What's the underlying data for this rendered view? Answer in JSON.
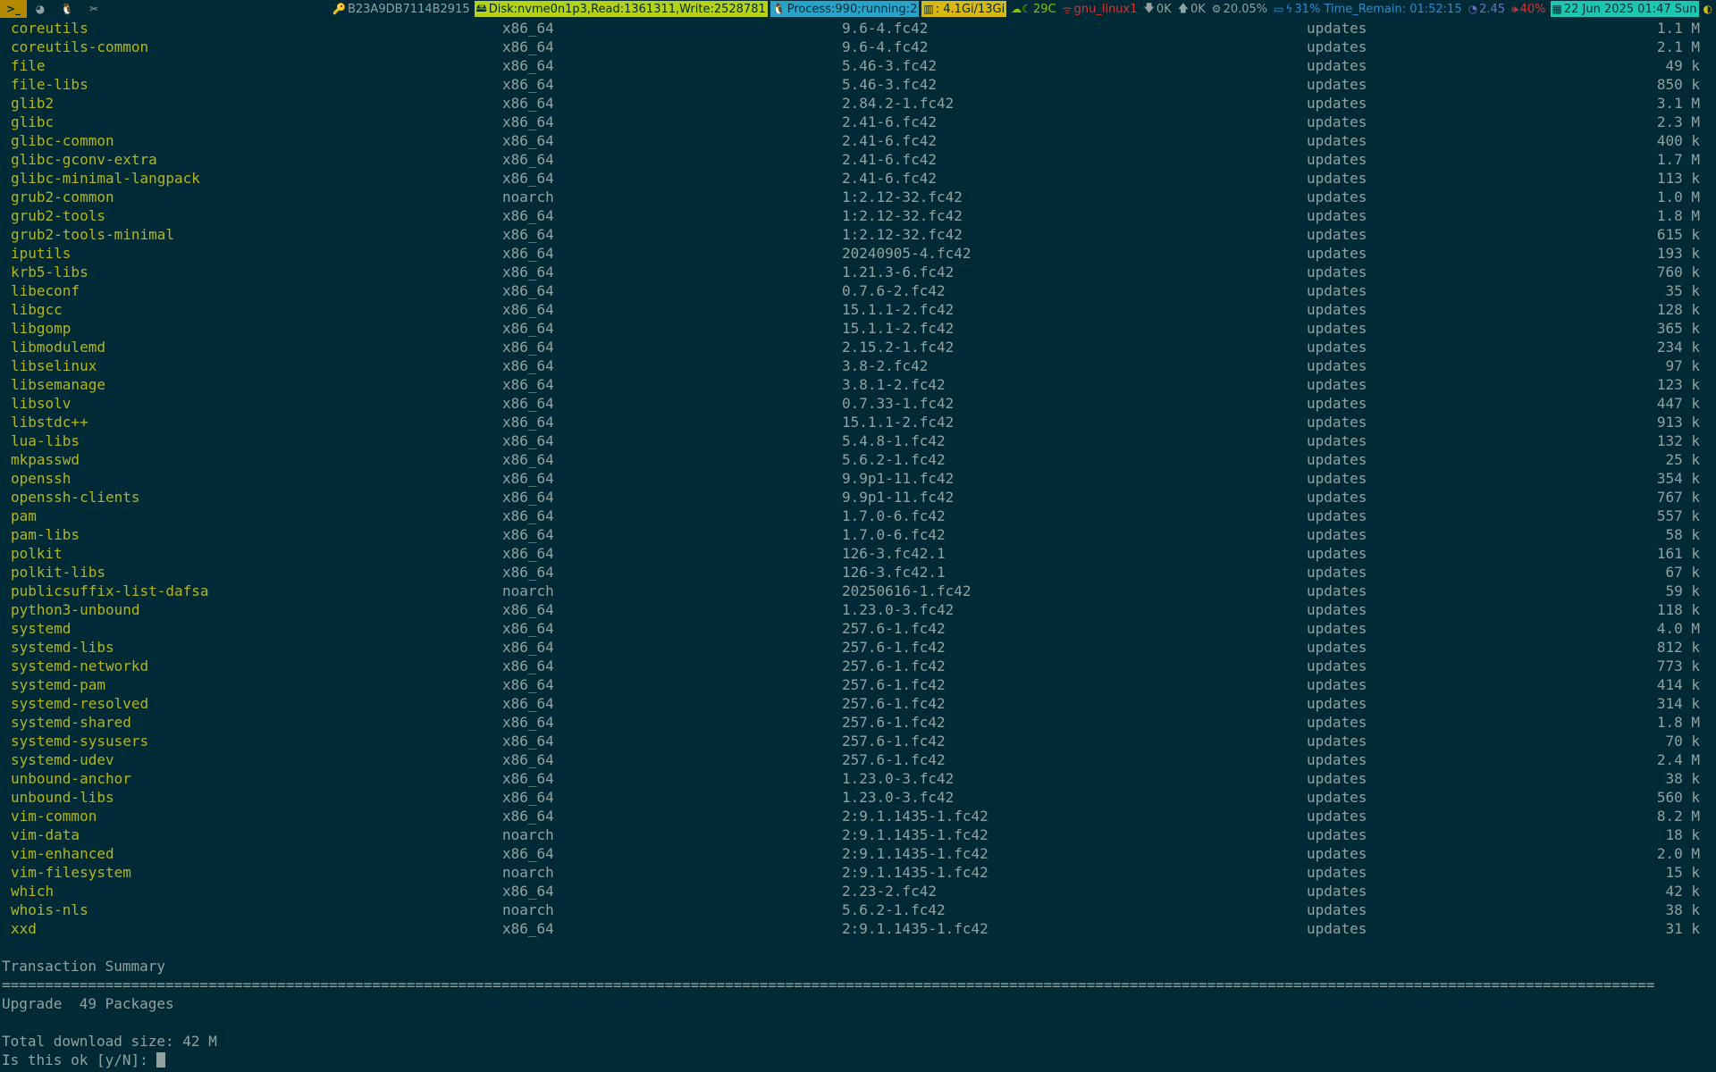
{
  "topbar": {
    "workspaces": [
      {
        "label": ">_",
        "active": true
      },
      {
        "label": "◕",
        "active": false
      },
      {
        "label": "🐧",
        "active": false
      },
      {
        "label": "✂",
        "active": false
      }
    ],
    "host_id": "B23A9DB7114B2915",
    "disk": "Disk:nvme0n1p3,Read:1361311,Write:2528781",
    "process": "Process:990;running:2",
    "memory": ": 4.1Gi/13Gi",
    "weather": "29C",
    "network_name": "gnu_linux1",
    "net_down": "0K",
    "net_up": "0K",
    "cpu": "20.05%",
    "battery": "31%",
    "time_remain": "Time_Remain: 01:52:15",
    "load": "2.45",
    "volume": "40%",
    "datetime": "22 Jun 2025 01:47 Sun",
    "colors": {
      "disk_bg": "#b5d118",
      "process_bg": "#2aa3c9",
      "memory_bg": "#d9b814",
      "date_bg": "#1cc6b0"
    }
  },
  "packages": [
    {
      "name": "coreutils",
      "arch": "x86_64",
      "version": "9.6-4.fc42",
      "repo": "updates",
      "size": "1.1 M"
    },
    {
      "name": "coreutils-common",
      "arch": "x86_64",
      "version": "9.6-4.fc42",
      "repo": "updates",
      "size": "2.1 M"
    },
    {
      "name": "file",
      "arch": "x86_64",
      "version": "5.46-3.fc42",
      "repo": "updates",
      "size": "49 k"
    },
    {
      "name": "file-libs",
      "arch": "x86_64",
      "version": "5.46-3.fc42",
      "repo": "updates",
      "size": "850 k"
    },
    {
      "name": "glib2",
      "arch": "x86_64",
      "version": "2.84.2-1.fc42",
      "repo": "updates",
      "size": "3.1 M"
    },
    {
      "name": "glibc",
      "arch": "x86_64",
      "version": "2.41-6.fc42",
      "repo": "updates",
      "size": "2.3 M"
    },
    {
      "name": "glibc-common",
      "arch": "x86_64",
      "version": "2.41-6.fc42",
      "repo": "updates",
      "size": "400 k"
    },
    {
      "name": "glibc-gconv-extra",
      "arch": "x86_64",
      "version": "2.41-6.fc42",
      "repo": "updates",
      "size": "1.7 M"
    },
    {
      "name": "glibc-minimal-langpack",
      "arch": "x86_64",
      "version": "2.41-6.fc42",
      "repo": "updates",
      "size": "113 k"
    },
    {
      "name": "grub2-common",
      "arch": "noarch",
      "version": "1:2.12-32.fc42",
      "repo": "updates",
      "size": "1.0 M"
    },
    {
      "name": "grub2-tools",
      "arch": "x86_64",
      "version": "1:2.12-32.fc42",
      "repo": "updates",
      "size": "1.8 M"
    },
    {
      "name": "grub2-tools-minimal",
      "arch": "x86_64",
      "version": "1:2.12-32.fc42",
      "repo": "updates",
      "size": "615 k"
    },
    {
      "name": "iputils",
      "arch": "x86_64",
      "version": "20240905-4.fc42",
      "repo": "updates",
      "size": "193 k"
    },
    {
      "name": "krb5-libs",
      "arch": "x86_64",
      "version": "1.21.3-6.fc42",
      "repo": "updates",
      "size": "760 k"
    },
    {
      "name": "libeconf",
      "arch": "x86_64",
      "version": "0.7.6-2.fc42",
      "repo": "updates",
      "size": "35 k"
    },
    {
      "name": "libgcc",
      "arch": "x86_64",
      "version": "15.1.1-2.fc42",
      "repo": "updates",
      "size": "128 k"
    },
    {
      "name": "libgomp",
      "arch": "x86_64",
      "version": "15.1.1-2.fc42",
      "repo": "updates",
      "size": "365 k"
    },
    {
      "name": "libmodulemd",
      "arch": "x86_64",
      "version": "2.15.2-1.fc42",
      "repo": "updates",
      "size": "234 k"
    },
    {
      "name": "libselinux",
      "arch": "x86_64",
      "version": "3.8-2.fc42",
      "repo": "updates",
      "size": "97 k"
    },
    {
      "name": "libsemanage",
      "arch": "x86_64",
      "version": "3.8.1-2.fc42",
      "repo": "updates",
      "size": "123 k"
    },
    {
      "name": "libsolv",
      "arch": "x86_64",
      "version": "0.7.33-1.fc42",
      "repo": "updates",
      "size": "447 k"
    },
    {
      "name": "libstdc++",
      "arch": "x86_64",
      "version": "15.1.1-2.fc42",
      "repo": "updates",
      "size": "913 k"
    },
    {
      "name": "lua-libs",
      "arch": "x86_64",
      "version": "5.4.8-1.fc42",
      "repo": "updates",
      "size": "132 k"
    },
    {
      "name": "mkpasswd",
      "arch": "x86_64",
      "version": "5.6.2-1.fc42",
      "repo": "updates",
      "size": "25 k"
    },
    {
      "name": "openssh",
      "arch": "x86_64",
      "version": "9.9p1-11.fc42",
      "repo": "updates",
      "size": "354 k"
    },
    {
      "name": "openssh-clients",
      "arch": "x86_64",
      "version": "9.9p1-11.fc42",
      "repo": "updates",
      "size": "767 k"
    },
    {
      "name": "pam",
      "arch": "x86_64",
      "version": "1.7.0-6.fc42",
      "repo": "updates",
      "size": "557 k"
    },
    {
      "name": "pam-libs",
      "arch": "x86_64",
      "version": "1.7.0-6.fc42",
      "repo": "updates",
      "size": "58 k"
    },
    {
      "name": "polkit",
      "arch": "x86_64",
      "version": "126-3.fc42.1",
      "repo": "updates",
      "size": "161 k"
    },
    {
      "name": "polkit-libs",
      "arch": "x86_64",
      "version": "126-3.fc42.1",
      "repo": "updates",
      "size": "67 k"
    },
    {
      "name": "publicsuffix-list-dafsa",
      "arch": "noarch",
      "version": "20250616-1.fc42",
      "repo": "updates",
      "size": "59 k"
    },
    {
      "name": "python3-unbound",
      "arch": "x86_64",
      "version": "1.23.0-3.fc42",
      "repo": "updates",
      "size": "118 k"
    },
    {
      "name": "systemd",
      "arch": "x86_64",
      "version": "257.6-1.fc42",
      "repo": "updates",
      "size": "4.0 M"
    },
    {
      "name": "systemd-libs",
      "arch": "x86_64",
      "version": "257.6-1.fc42",
      "repo": "updates",
      "size": "812 k"
    },
    {
      "name": "systemd-networkd",
      "arch": "x86_64",
      "version": "257.6-1.fc42",
      "repo": "updates",
      "size": "773 k"
    },
    {
      "name": "systemd-pam",
      "arch": "x86_64",
      "version": "257.6-1.fc42",
      "repo": "updates",
      "size": "414 k"
    },
    {
      "name": "systemd-resolved",
      "arch": "x86_64",
      "version": "257.6-1.fc42",
      "repo": "updates",
      "size": "314 k"
    },
    {
      "name": "systemd-shared",
      "arch": "x86_64",
      "version": "257.6-1.fc42",
      "repo": "updates",
      "size": "1.8 M"
    },
    {
      "name": "systemd-sysusers",
      "arch": "x86_64",
      "version": "257.6-1.fc42",
      "repo": "updates",
      "size": "70 k"
    },
    {
      "name": "systemd-udev",
      "arch": "x86_64",
      "version": "257.6-1.fc42",
      "repo": "updates",
      "size": "2.4 M"
    },
    {
      "name": "unbound-anchor",
      "arch": "x86_64",
      "version": "1.23.0-3.fc42",
      "repo": "updates",
      "size": "38 k"
    },
    {
      "name": "unbound-libs",
      "arch": "x86_64",
      "version": "1.23.0-3.fc42",
      "repo": "updates",
      "size": "560 k"
    },
    {
      "name": "vim-common",
      "arch": "x86_64",
      "version": "2:9.1.1435-1.fc42",
      "repo": "updates",
      "size": "8.2 M"
    },
    {
      "name": "vim-data",
      "arch": "noarch",
      "version": "2:9.1.1435-1.fc42",
      "repo": "updates",
      "size": "18 k"
    },
    {
      "name": "vim-enhanced",
      "arch": "x86_64",
      "version": "2:9.1.1435-1.fc42",
      "repo": "updates",
      "size": "2.0 M"
    },
    {
      "name": "vim-filesystem",
      "arch": "noarch",
      "version": "2:9.1.1435-1.fc42",
      "repo": "updates",
      "size": "15 k"
    },
    {
      "name": "which",
      "arch": "x86_64",
      "version": "2.23-2.fc42",
      "repo": "updates",
      "size": "42 k"
    },
    {
      "name": "whois-nls",
      "arch": "noarch",
      "version": "5.6.2-1.fc42",
      "repo": "updates",
      "size": "38 k"
    },
    {
      "name": "xxd",
      "arch": "x86_64",
      "version": "2:9.1.1435-1.fc42",
      "repo": "updates",
      "size": "31 k"
    }
  ],
  "summary": {
    "heading": "Transaction Summary",
    "separator": "================================================================================================================================================================================================",
    "upgrade_line": "Upgrade  49 Packages",
    "download_line": "Total download size: 42 M",
    "prompt": "Is this ok [y/N]: "
  }
}
